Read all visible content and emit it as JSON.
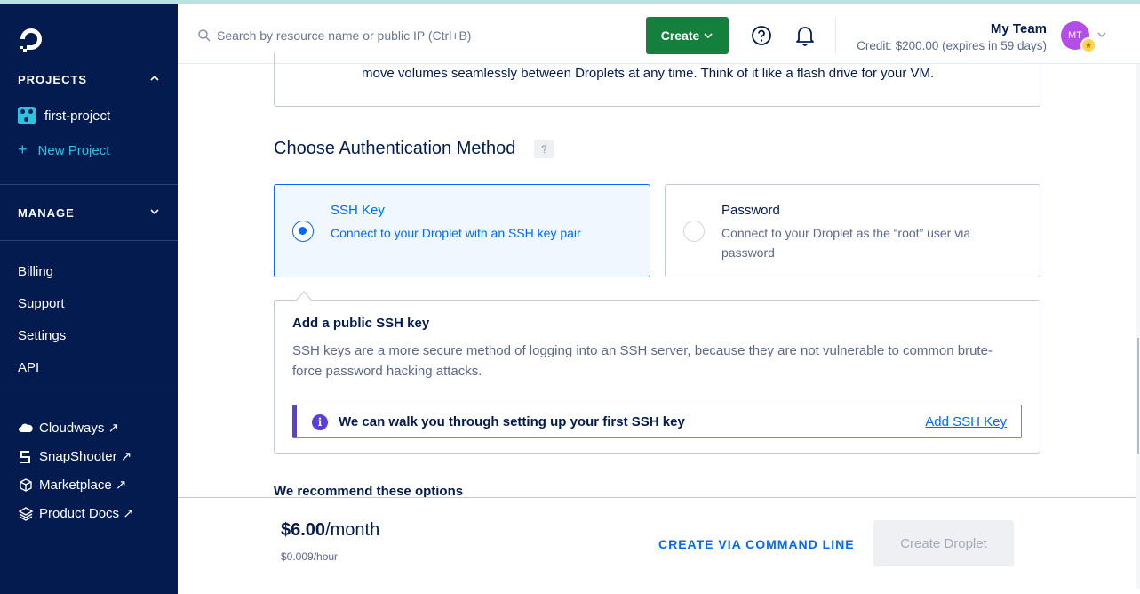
{
  "colors": {
    "sidebar_bg": "#031b4e",
    "accent": "#0069ff",
    "create_green": "#15803d",
    "info_purple": "#5b3fd9",
    "teal": "#2dc2e0"
  },
  "sidebar": {
    "projects_heading": "PROJECTS",
    "project_name": "first-project",
    "new_project": "New Project",
    "manage_heading": "MANAGE",
    "items": [
      "Billing",
      "Support",
      "Settings",
      "API"
    ],
    "external": [
      {
        "label": "Cloudways",
        "icon": "cloud-icon"
      },
      {
        "label": "SnapShooter",
        "icon": "snapshooter-icon"
      },
      {
        "label": "Marketplace",
        "icon": "cube-icon"
      },
      {
        "label": "Product Docs",
        "icon": "layers-icon"
      }
    ]
  },
  "topbar": {
    "search_placeholder": "Search by resource name or public IP (Ctrl+B)",
    "create_label": "Create",
    "team_name": "My Team",
    "credit": "Credit: $200.00 (expires in 59 days)",
    "avatar_initials": "MT"
  },
  "main": {
    "volume_text": "move volumes seamlessly between Droplets at any time. Think of it like a flash drive for your VM.",
    "auth_title": "Choose Authentication Method",
    "help_badge": "?",
    "ssh_option": {
      "title": "SSH Key",
      "desc": "Connect to your Droplet with an SSH key pair",
      "selected": true
    },
    "password_option": {
      "title": "Password",
      "desc": "Connect to your Droplet as the “root” user via password",
      "selected": false
    },
    "ssh_box": {
      "title": "Add a public SSH key",
      "desc": "SSH keys are a more secure method of logging into an SSH server, because they are not vulnerable to common brute-force password hacking attacks.",
      "info_text": "We can walk you through setting up your first SSH key",
      "info_link": "Add SSH Key"
    },
    "recommend": "We recommend these options"
  },
  "footer": {
    "price_amount": "$6.00",
    "price_unit": "/month",
    "hourly": "$0.009/hour",
    "cli_link": "CREATE VIA COMMAND LINE",
    "create_droplet": "Create Droplet"
  }
}
